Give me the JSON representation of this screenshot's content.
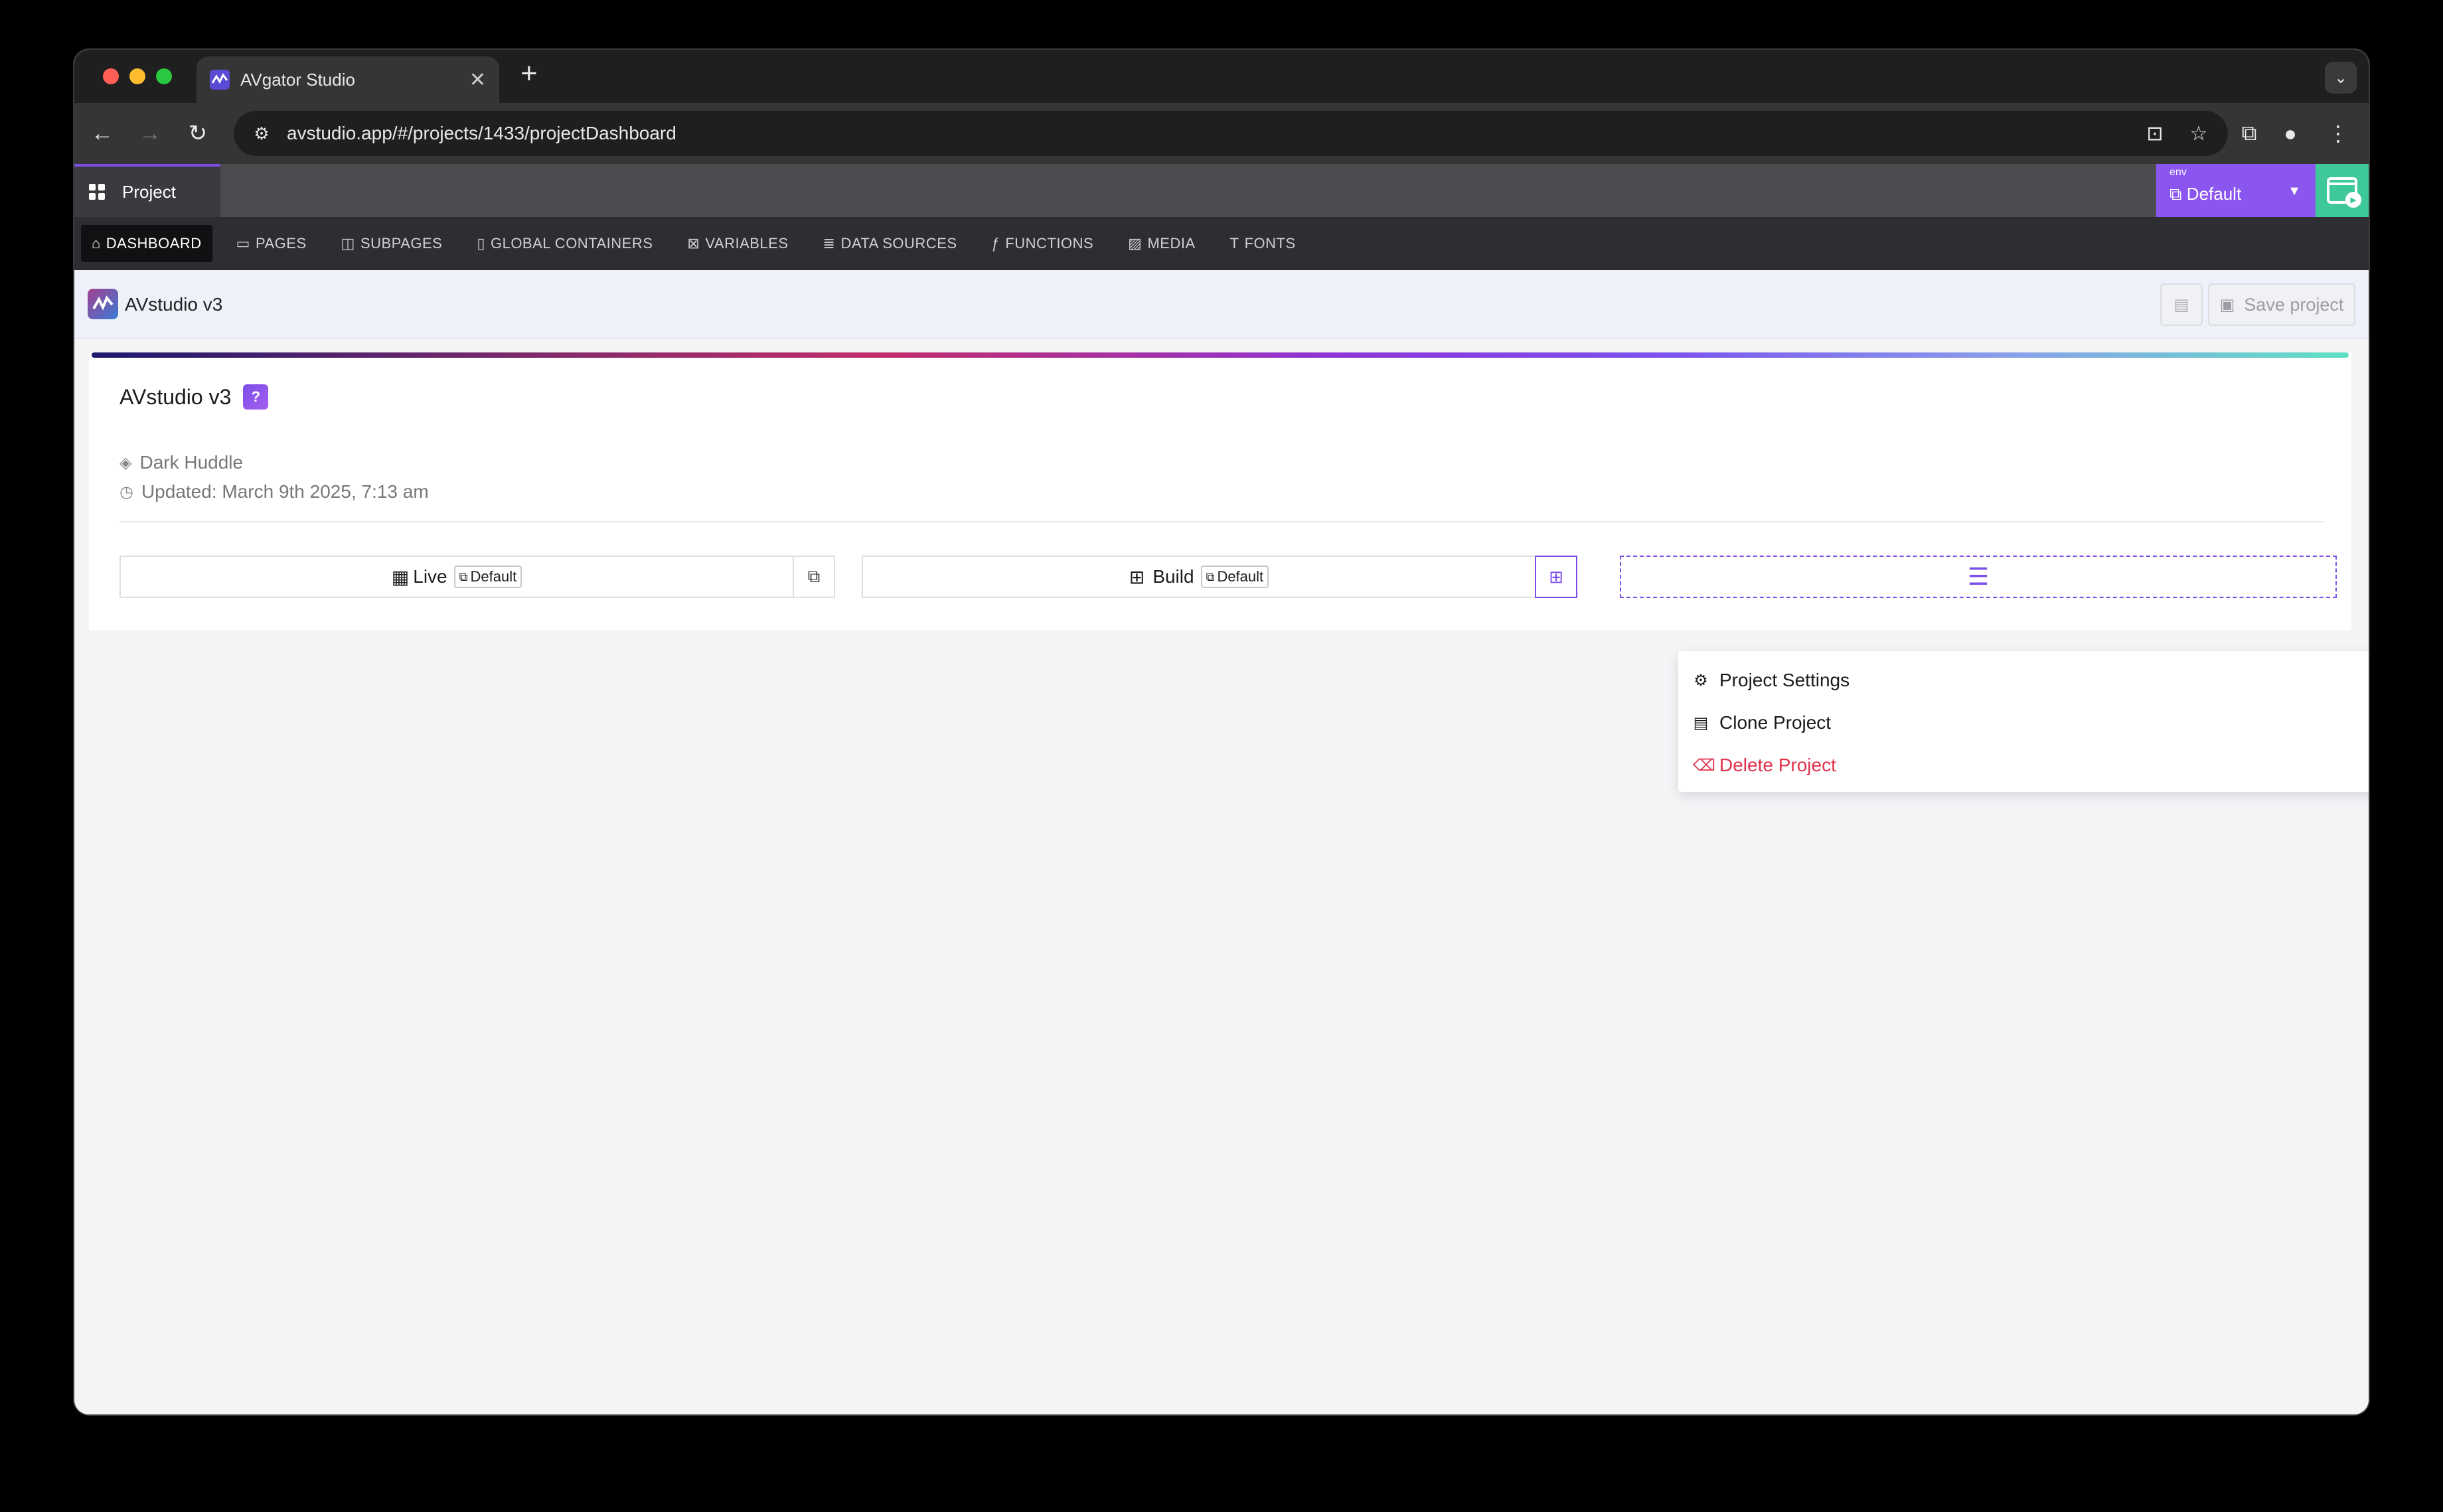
{
  "browser": {
    "tab_title": "AVgator Studio",
    "tab_close": "✕",
    "new_tab": "+",
    "url": "avstudio.app/#/projects/1433/projectDashboard",
    "traffic_colors": [
      "#ff5f57",
      "#febc2e",
      "#28c840"
    ]
  },
  "app": {
    "project_tab_label": "Project",
    "env": {
      "label": "env",
      "value": "Default"
    },
    "nav": [
      {
        "label": "DASHBOARD",
        "icon": "home-icon",
        "glyph": "⌂",
        "active": true
      },
      {
        "label": "PAGES",
        "icon": "page-icon",
        "glyph": "▭"
      },
      {
        "label": "SUBPAGES",
        "icon": "subpage-icon",
        "glyph": "◫"
      },
      {
        "label": "GLOBAL CONTAINERS",
        "icon": "container-icon",
        "glyph": "▯"
      },
      {
        "label": "VARIABLES",
        "icon": "variable-icon",
        "glyph": "⊠"
      },
      {
        "label": "DATA SOURCES",
        "icon": "database-icon",
        "glyph": "≣"
      },
      {
        "label": "FUNCTIONS",
        "icon": "function-icon",
        "glyph": "ƒ"
      },
      {
        "label": "MEDIA",
        "icon": "image-icon",
        "glyph": "▨"
      },
      {
        "label": "FONTS",
        "icon": "font-icon",
        "glyph": "T"
      }
    ],
    "header_project_name": "AVstudio v3",
    "save_label": "Save project"
  },
  "project": {
    "title": "AVstudio v3",
    "help_badge": "?",
    "theme": "Dark Huddle",
    "updated": "Updated: March 9th 2025, 7:13 am"
  },
  "actions": {
    "live_label": "Live",
    "live_env": "Default",
    "build_label": "Build",
    "build_env": "Default"
  },
  "menu": {
    "items": [
      {
        "label": "Project Settings",
        "icon": "gear-icon"
      },
      {
        "label": "Clone Project",
        "icon": "clipboard-icon"
      },
      {
        "label": "Delete Project",
        "icon": "trash-icon",
        "danger": true
      }
    ],
    "danger_color": "#e0304a"
  },
  "colors": {
    "accent": "#7c4ee8",
    "env_bg": "#8b55f0",
    "run_bg": "#3fc99a"
  }
}
